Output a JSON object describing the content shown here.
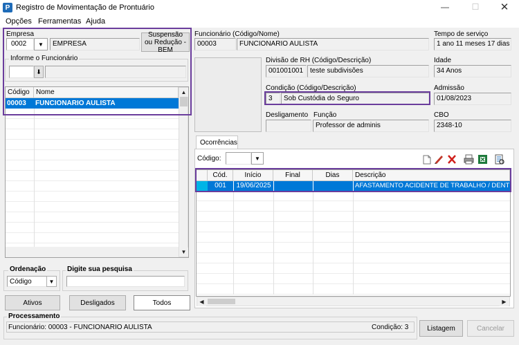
{
  "window": {
    "title": "Registro de Movimentação de Prontuário",
    "app_icon_letter": "P"
  },
  "menu": [
    "Opções",
    "Ferramentas",
    "Ajuda"
  ],
  "empresa": {
    "label": "Empresa",
    "code": "0002",
    "name": "EMPRESA",
    "suspensao_button": "Suspensão ou Redução - BEM"
  },
  "informe": {
    "label": "Informe o Funcionário"
  },
  "emp_list": {
    "headers": [
      "Código",
      "Nome"
    ],
    "rows": [
      {
        "code": "00003",
        "name": "FUNCIONARIO AULISTA"
      }
    ]
  },
  "ordenacao": {
    "label": "Ordenação",
    "value": "Código"
  },
  "search": {
    "label": "Digite sua pesquisa",
    "value": ""
  },
  "filter_buttons": [
    "Ativos",
    "Desligados",
    "Todos"
  ],
  "funcionario": {
    "label": "Funcionário (Código/Nome)",
    "code": "00003",
    "name": "FUNCIONARIO  AULISTA"
  },
  "tempo": {
    "label": "Tempo de serviço",
    "value": "1 ano 11 meses 17 dias"
  },
  "divisao": {
    "label": "Divisão de RH (Código/Descrição)",
    "code": "001001001",
    "desc": "teste subdivisões"
  },
  "idade": {
    "label": "Idade",
    "value": "34 Anos"
  },
  "condicao": {
    "label": "Condição (Código/Descrição)",
    "code": "3",
    "desc": "Sob Custódia do Seguro"
  },
  "admissao": {
    "label": "Admissão",
    "value": "01/08/2023"
  },
  "desligamento": {
    "label": "Desligamento",
    "value": ""
  },
  "funcao": {
    "label": "Função",
    "value": "Professor de adminis"
  },
  "cbo": {
    "label": "CBO",
    "value": "2348-10"
  },
  "ocorrencias": {
    "tab": "Ocorrências",
    "codigo_label": "Código:",
    "headers": [
      "Cód.",
      "Início",
      "Final",
      "Dias",
      "Descrição"
    ],
    "rows": [
      {
        "cod": "001",
        "inicio": "19/06/2025",
        "final": "",
        "dias": "",
        "descricao": "AFASTAMENTO ACIDENTE DE TRABALHO / DENTRO"
      }
    ]
  },
  "processamento": {
    "label": "Processamento",
    "status": "Funcionário: 00003 - FUNCIONARIO  AULISTA",
    "condicao": "Condição: 3"
  },
  "bottom_buttons": {
    "listagem": "Listagem",
    "cancelar": "Cancelar"
  },
  "colors": {
    "selection": "#0078d7",
    "highlight_border": "#6a3c9c",
    "icon_blue": "#1e6bb8"
  }
}
